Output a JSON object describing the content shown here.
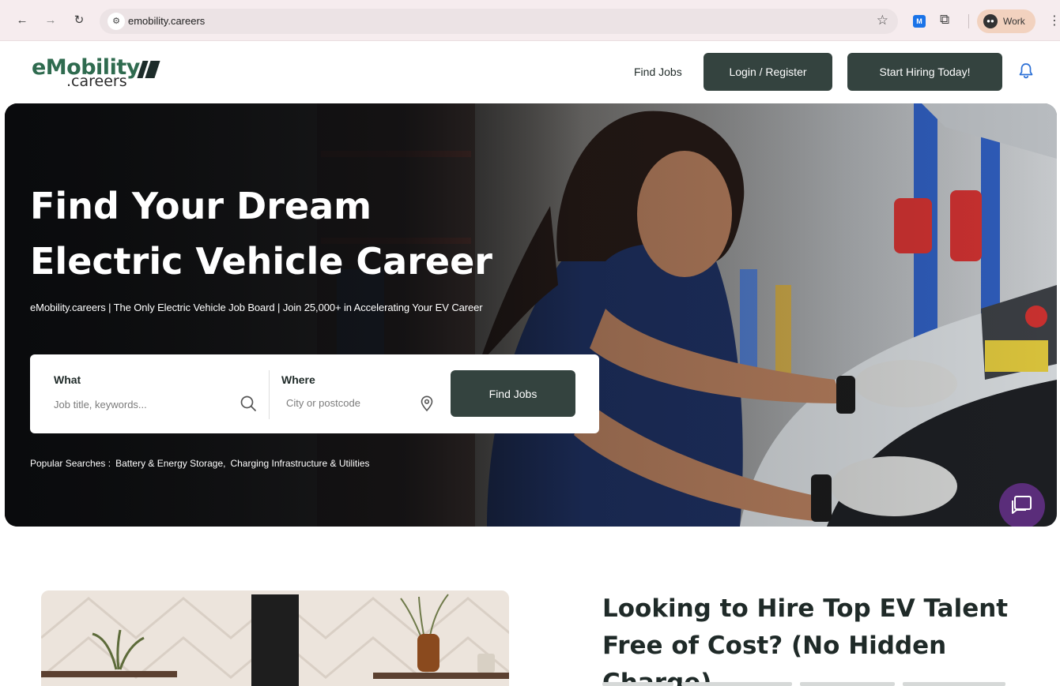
{
  "browser": {
    "url": "emobility.careers",
    "profile_label": "Work",
    "extension_label": "M"
  },
  "header": {
    "logo_main": "eMobility",
    "logo_sub": ".careers",
    "nav_find_jobs": "Find Jobs",
    "login_label": "Login / Register",
    "hire_label": "Start Hiring Today!"
  },
  "hero": {
    "title": "Find Your Dream Electric Vehicle Career",
    "subtitle": "eMobility.careers | The Only Electric Vehicle Job Board | Join 25,000+ in Accelerating Your EV Career",
    "search": {
      "what_label": "What",
      "what_placeholder": "Job title, keywords...",
      "where_label": "Where",
      "where_placeholder": "City or postcode",
      "button_label": "Find Jobs"
    },
    "popular_label": "Popular Searches :",
    "popular_tags": [
      "Battery & Energy Storage,",
      "Charging Infrastructure & Utilities"
    ]
  },
  "promo": {
    "title": "Looking to Hire Top EV Talent Free of Cost? (No Hidden Charge)"
  },
  "colors": {
    "brand_green": "#2f6b4f",
    "button_dark": "#34433f",
    "chat_purple": "#5a2d7a",
    "bell_blue": "#2a6fd6"
  },
  "icons": [
    "back-arrow-icon",
    "forward-arrow-icon",
    "reload-icon",
    "site-settings-icon",
    "bookmark-star-icon",
    "extensions-icon",
    "menu-dots-icon",
    "bell-icon",
    "search-icon",
    "location-pin-icon",
    "chat-icon"
  ]
}
